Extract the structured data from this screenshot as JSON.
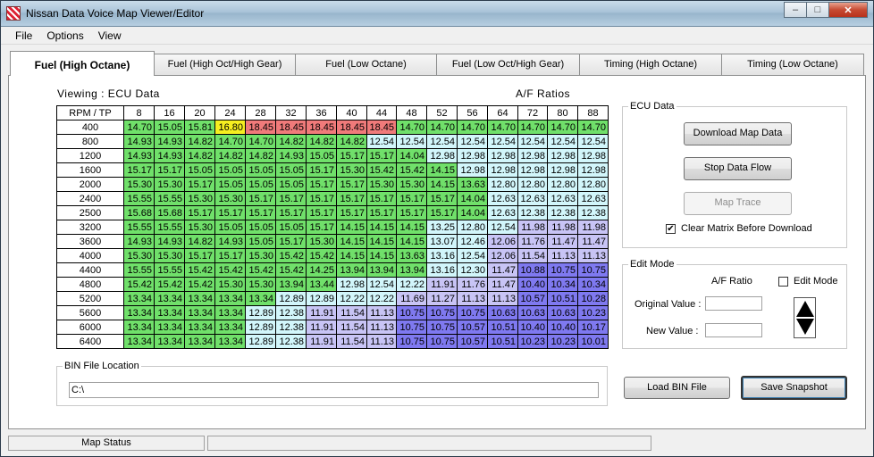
{
  "window": {
    "title": "Nissan Data Voice Map Viewer/Editor",
    "minimize": "‒",
    "maximize": "□",
    "close": "✕"
  },
  "menu": [
    "File",
    "Options",
    "View"
  ],
  "tabs": [
    "Fuel (High Octane)",
    "Fuel (High Oct/High Gear)",
    "Fuel (Low Octane)",
    "Fuel (Low Oct/High Gear)",
    "Timing (High Octane)",
    "Timing (Low Octane)"
  ],
  "active_tab": 0,
  "viewing_label": "Viewing : ECU Data",
  "table_title": "A/F Ratios",
  "map": {
    "corner_label": "RPM / TP",
    "tp": [
      "8",
      "16",
      "20",
      "24",
      "28",
      "32",
      "36",
      "40",
      "44",
      "48",
      "52",
      "56",
      "64",
      "72",
      "80",
      "88"
    ],
    "rows": [
      {
        "rpm": "400",
        "values": [
          "14.70",
          "15.05",
          "15.81",
          "16.80",
          "18.45",
          "18.45",
          "18.45",
          "18.45",
          "18.45",
          "14.70",
          "14.70",
          "14.70",
          "14.70",
          "14.70",
          "14.70",
          "14.70"
        ]
      },
      {
        "rpm": "800",
        "values": [
          "14.93",
          "14.93",
          "14.82",
          "14.70",
          "14.70",
          "14.82",
          "14.82",
          "14.82",
          "12.54",
          "12.54",
          "12.54",
          "12.54",
          "12.54",
          "12.54",
          "12.54",
          "12.54"
        ]
      },
      {
        "rpm": "1200",
        "values": [
          "14.93",
          "14.93",
          "14.82",
          "14.82",
          "14.82",
          "14.93",
          "15.05",
          "15.17",
          "15.17",
          "14.04",
          "12.98",
          "12.98",
          "12.98",
          "12.98",
          "12.98",
          "12.98"
        ]
      },
      {
        "rpm": "1600",
        "values": [
          "15.17",
          "15.17",
          "15.05",
          "15.05",
          "15.05",
          "15.05",
          "15.17",
          "15.30",
          "15.42",
          "15.42",
          "14.15",
          "12.98",
          "12.98",
          "12.98",
          "12.98",
          "12.98"
        ]
      },
      {
        "rpm": "2000",
        "values": [
          "15.30",
          "15.30",
          "15.17",
          "15.05",
          "15.05",
          "15.05",
          "15.17",
          "15.17",
          "15.30",
          "15.30",
          "14.15",
          "13.63",
          "12.80",
          "12.80",
          "12.80",
          "12.80"
        ]
      },
      {
        "rpm": "2400",
        "values": [
          "15.55",
          "15.55",
          "15.30",
          "15.30",
          "15.17",
          "15.17",
          "15.17",
          "15.17",
          "15.17",
          "15.17",
          "15.17",
          "14.04",
          "12.63",
          "12.63",
          "12.63",
          "12.63"
        ]
      },
      {
        "rpm": "2500",
        "values": [
          "15.68",
          "15.68",
          "15.17",
          "15.17",
          "15.17",
          "15.17",
          "15.17",
          "15.17",
          "15.17",
          "15.17",
          "15.17",
          "14.04",
          "12.63",
          "12.38",
          "12.38",
          "12.38"
        ]
      },
      {
        "rpm": "3200",
        "values": [
          "15.55",
          "15.55",
          "15.30",
          "15.05",
          "15.05",
          "15.05",
          "15.17",
          "14.15",
          "14.15",
          "14.15",
          "13.25",
          "12.80",
          "12.54",
          "11.98",
          "11.98",
          "11.98"
        ]
      },
      {
        "rpm": "3600",
        "values": [
          "14.93",
          "14.93",
          "14.82",
          "14.93",
          "15.05",
          "15.17",
          "15.30",
          "14.15",
          "14.15",
          "14.15",
          "13.07",
          "12.46",
          "12.06",
          "11.76",
          "11.47",
          "11.47"
        ]
      },
      {
        "rpm": "4000",
        "values": [
          "15.30",
          "15.30",
          "15.17",
          "15.17",
          "15.30",
          "15.42",
          "15.42",
          "14.15",
          "14.15",
          "13.63",
          "13.16",
          "12.54",
          "12.06",
          "11.54",
          "11.13",
          "11.13"
        ]
      },
      {
        "rpm": "4400",
        "values": [
          "15.55",
          "15.55",
          "15.42",
          "15.42",
          "15.42",
          "15.42",
          "14.25",
          "13.94",
          "13.94",
          "13.94",
          "13.16",
          "12.30",
          "11.47",
          "10.88",
          "10.75",
          "10.75"
        ]
      },
      {
        "rpm": "4800",
        "values": [
          "15.42",
          "15.42",
          "15.42",
          "15.30",
          "15.30",
          "13.94",
          "13.44",
          "12.98",
          "12.54",
          "12.22",
          "11.91",
          "11.76",
          "11.47",
          "10.40",
          "10.34",
          "10.34"
        ]
      },
      {
        "rpm": "5200",
        "values": [
          "13.34",
          "13.34",
          "13.34",
          "13.34",
          "13.34",
          "12.89",
          "12.89",
          "12.22",
          "12.22",
          "11.69",
          "11.27",
          "11.13",
          "11.13",
          "10.57",
          "10.51",
          "10.28"
        ]
      },
      {
        "rpm": "5600",
        "values": [
          "13.34",
          "13.34",
          "13.34",
          "13.34",
          "12.89",
          "12.38",
          "11.91",
          "11.54",
          "11.13",
          "10.75",
          "10.75",
          "10.75",
          "10.63",
          "10.63",
          "10.63",
          "10.23"
        ]
      },
      {
        "rpm": "6000",
        "values": [
          "13.34",
          "13.34",
          "13.34",
          "13.34",
          "12.89",
          "12.38",
          "11.91",
          "11.54",
          "11.13",
          "10.75",
          "10.75",
          "10.57",
          "10.51",
          "10.40",
          "10.40",
          "10.17"
        ]
      },
      {
        "rpm": "6400",
        "values": [
          "13.34",
          "13.34",
          "13.34",
          "13.34",
          "12.89",
          "12.38",
          "11.91",
          "11.54",
          "11.13",
          "10.75",
          "10.75",
          "10.57",
          "10.51",
          "10.23",
          "10.23",
          "10.01"
        ]
      }
    ]
  },
  "colors": {
    "green": "#70e06a",
    "light_blue": "#d2f6fb",
    "lavender": "#c8c4f5",
    "purple": "#7f79f0",
    "red": "#f07a7a",
    "yellow": "#f5ee20"
  },
  "ecu_data": {
    "title": "ECU Data",
    "download_button": "Download Map Data",
    "stop_button": "Stop Data Flow",
    "trace_button": "Map Trace",
    "clear_matrix_label": "Clear Matrix Before Download",
    "clear_matrix_checked": true
  },
  "edit_mode": {
    "title": "Edit Mode",
    "afr_label": "A/F Ratio",
    "edit_mode_label": "Edit Mode",
    "edit_mode_checked": false,
    "original_label": "Original Value :",
    "original_value": "",
    "new_label": "New Value :",
    "new_value": ""
  },
  "bin": {
    "title": "BIN File Location",
    "path": "C:\\",
    "load_button": "Load BIN File",
    "save_button": "Save Snapshot"
  },
  "status": {
    "map_status": "Map Status",
    "message": ""
  }
}
